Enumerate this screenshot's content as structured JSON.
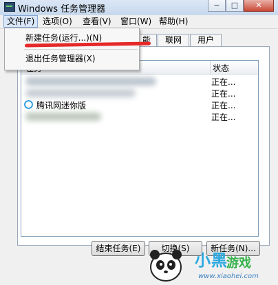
{
  "window": {
    "title": "Windows 任务管理器",
    "buttons": [
      "−",
      "□",
      "✕"
    ]
  },
  "menu": {
    "items": [
      "文件(F)",
      "选项(O)",
      "查看(V)",
      "窗口(W)",
      "帮助(H)"
    ],
    "dropdown": [
      "新建任务(运行...)(N)",
      "退出任务管理器(X)"
    ]
  },
  "tabs": [
    "能",
    "联网",
    "用户"
  ],
  "list": {
    "headers": [
      "任务",
      "状态"
    ],
    "rows": [
      {
        "name": "",
        "status": "正在..."
      },
      {
        "name": "",
        "status": "正在..."
      },
      {
        "name": "腾讯网迷你版",
        "status": "正在..."
      },
      {
        "name": "",
        "status": "正在..."
      }
    ]
  },
  "buttons": {
    "end_task": "结束任务(E)",
    "switch": "切换(S)",
    "new_task": "新任务(N)..."
  },
  "watermark": {
    "brand": "小黑",
    "brand2": "游戏",
    "url": "www.xiaohei.com"
  }
}
